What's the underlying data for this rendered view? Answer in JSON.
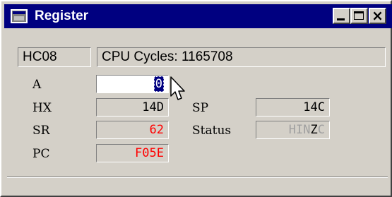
{
  "window": {
    "title": "Register",
    "icon": "register-window-icon",
    "controls": [
      "minimize-icon",
      "maximize-icon",
      "close-icon"
    ]
  },
  "status": {
    "cpu": "HC08",
    "cycles_label": "CPU Cycles:",
    "cycles_value": "1165708"
  },
  "registers": {
    "A": {
      "label": "A",
      "value": "0"
    },
    "HX": {
      "label": "HX",
      "value": "14D"
    },
    "SR": {
      "label": "SR",
      "value": "62"
    },
    "PC": {
      "label": "PC",
      "value": "F05E"
    },
    "SP": {
      "label": "SP",
      "value": "14C"
    },
    "Status": {
      "label": "Status",
      "flags": [
        {
          "letter": "H",
          "set": false
        },
        {
          "letter": "I",
          "set": false
        },
        {
          "letter": "N",
          "set": false
        },
        {
          "letter": "Z",
          "set": true
        },
        {
          "letter": "C",
          "set": false
        }
      ]
    }
  },
  "colors": {
    "titlebar": "#000080",
    "changed_value": "#ff0000",
    "flag_clear": "#a0a0a0",
    "flag_set": "#000000"
  }
}
